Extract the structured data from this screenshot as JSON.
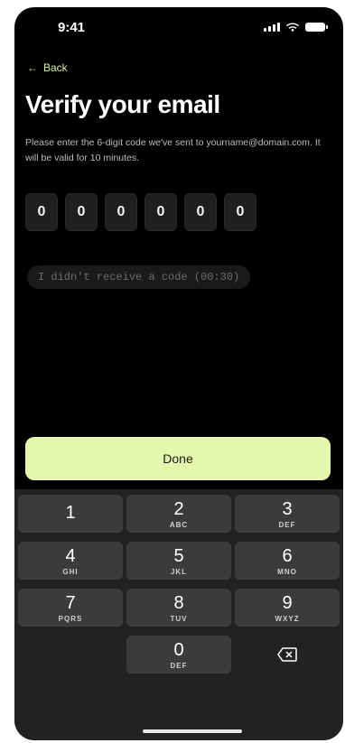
{
  "status": {
    "time": "9:41"
  },
  "nav": {
    "back_label": "Back"
  },
  "page": {
    "title": "Verify your email",
    "description": "Please enter the 6-digit code we've sent to yourname@domain.com. It will be valid for 10 minutes."
  },
  "code": {
    "digits": [
      "0",
      "0",
      "0",
      "0",
      "0",
      "0"
    ]
  },
  "resend": {
    "label": "I didn't receive a code (00:30)"
  },
  "actions": {
    "done_label": "Done"
  },
  "keypad": {
    "keys": [
      {
        "num": "1",
        "sub": ""
      },
      {
        "num": "2",
        "sub": "ABC"
      },
      {
        "num": "3",
        "sub": "DEF"
      },
      {
        "num": "4",
        "sub": "GHI"
      },
      {
        "num": "5",
        "sub": "JKL"
      },
      {
        "num": "6",
        "sub": "MNO"
      },
      {
        "num": "7",
        "sub": "PQRS"
      },
      {
        "num": "8",
        "sub": "TUV"
      },
      {
        "num": "9",
        "sub": "WXYZ"
      },
      {
        "num": "0",
        "sub": "DEF"
      }
    ]
  },
  "colors": {
    "accent": "#e5f7ac",
    "back_link": "#d7ef8f",
    "background": "#000000",
    "keyboard_bg": "#222222"
  }
}
